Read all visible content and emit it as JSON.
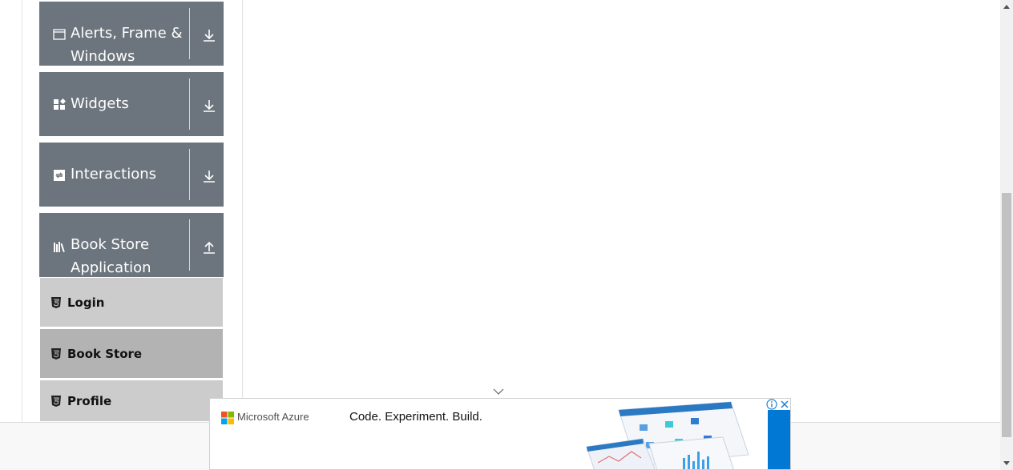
{
  "sidebar": {
    "groups": [
      {
        "label": "Alerts, Frame & Windows",
        "icon": "window-icon",
        "arrow": "arrow-down-icon"
      },
      {
        "label": "Widgets",
        "icon": "widgets-icon",
        "arrow": "arrow-down-icon"
      },
      {
        "label": "Interactions",
        "icon": "interactions-icon",
        "arrow": "arrow-down-icon"
      },
      {
        "label": "Book Store Application",
        "icon": "book-store-icon",
        "arrow": "arrow-up-icon"
      }
    ],
    "book_store_items": [
      {
        "label": "Login",
        "icon": "html5-icon"
      },
      {
        "label": "Book Store",
        "icon": "html5-icon",
        "active": true
      },
      {
        "label": "Profile",
        "icon": "html5-icon"
      }
    ]
  },
  "ad": {
    "brand": "Microsoft Azure",
    "tagline": "Code. Experiment. Build.",
    "accent": "#0078d4"
  },
  "colors": {
    "group_bg": "#6c757d",
    "item_bg": "#cccccc",
    "item_active_bg": "#b3b3b3"
  }
}
